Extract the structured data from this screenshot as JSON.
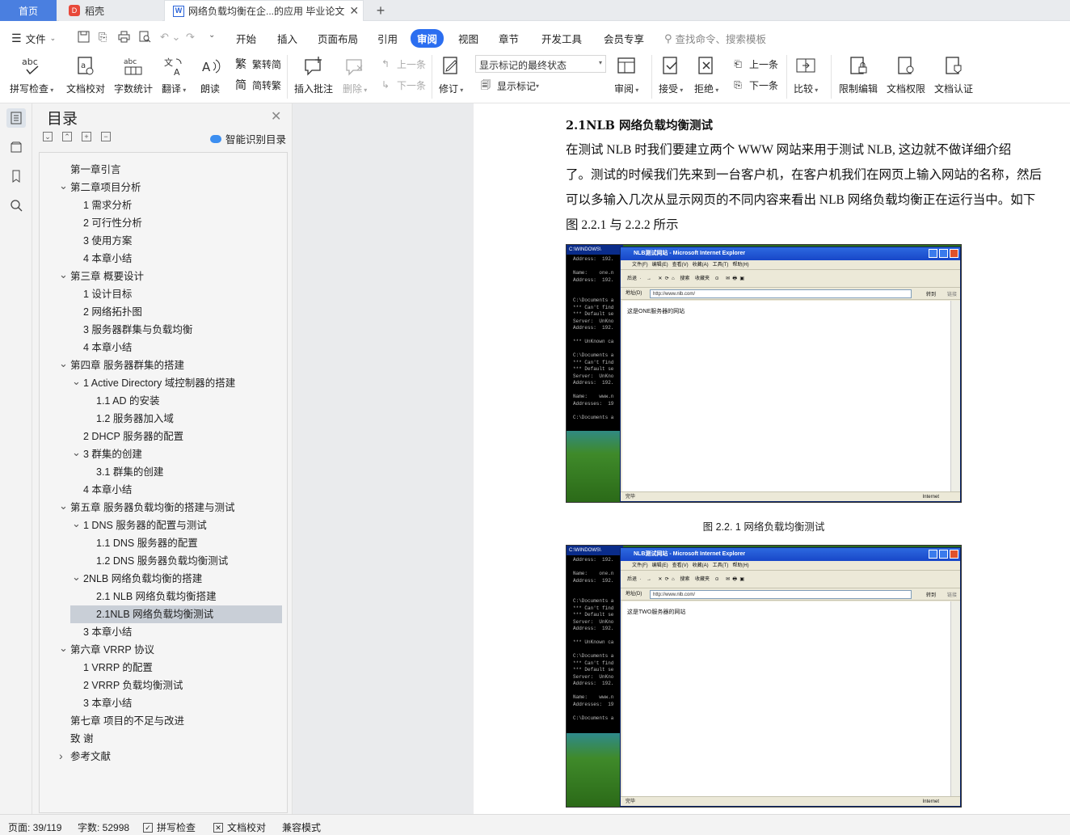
{
  "tabs": {
    "home": "首页",
    "daoke": "稻壳",
    "doc": "网络负载均衡在企...的应用 毕业论文"
  },
  "menu": {
    "file": "文件",
    "items": [
      "开始",
      "插入",
      "页面布局",
      "引用",
      "审阅",
      "视图",
      "章节",
      "开发工具",
      "会员专享"
    ],
    "search": "查找命令、搜索模板"
  },
  "ribbon": {
    "spellcheck": "拼写检查",
    "proofread": "文档校对",
    "wordcount": "字数统计",
    "translate": "翻译",
    "readaloud": "朗读",
    "to_traditional": "繁转简",
    "to_simplified": "简转繁",
    "insert_comment": "插入批注",
    "delete": "删除",
    "prev_comment": "上一条",
    "next_comment": "下一条",
    "revise": "修订",
    "markup_mode": "显示标记的最终状态",
    "show_markup": "显示标记",
    "review": "审阅",
    "accept": "接受",
    "reject": "拒绝",
    "prev_change": "上一条",
    "next_change": "下一条",
    "compare": "比较",
    "restrict_edit": "限制编辑",
    "doc_rights": "文档权限",
    "doc_cert": "文档认证"
  },
  "toc": {
    "title": "目录",
    "smart": "智能识别目录",
    "items": [
      {
        "text": "第一章引言",
        "expand": ""
      },
      {
        "text": "第二章项目分析",
        "expand": "down"
      },
      {
        "text": "1  需求分析",
        "expand": ""
      },
      {
        "text": "2  可行性分析",
        "expand": ""
      },
      {
        "text": "3  使用方案",
        "expand": ""
      },
      {
        "text": "4 本章小结",
        "expand": ""
      },
      {
        "text": "第三章  概要设计",
        "expand": "down"
      },
      {
        "text": "1 设计目标",
        "expand": ""
      },
      {
        "text": "2 网络拓扑图",
        "expand": ""
      },
      {
        "text": "3 服务器群集与负载均衡",
        "expand": ""
      },
      {
        "text": "4 本章小结",
        "expand": ""
      },
      {
        "text": "第四章  服务器群集的搭建",
        "expand": "down"
      },
      {
        "text": "1    Active Directory 域控制器的搭建",
        "expand": "down"
      },
      {
        "text": "1.1    AD 的安装",
        "expand": ""
      },
      {
        "text": "1.2  服务器加入域",
        "expand": ""
      },
      {
        "text": "2    DHCP 服务器的配置",
        "expand": ""
      },
      {
        "text": "3    群集的创建",
        "expand": "down"
      },
      {
        "text": "3.1  群集的创建",
        "expand": ""
      },
      {
        "text": "4    本章小结",
        "expand": ""
      },
      {
        "text": "第五章  服务器负载均衡的搭建与测试",
        "expand": "down"
      },
      {
        "text": "1    DNS 服务器的配置与测试",
        "expand": "down"
      },
      {
        "text": "1.1    DNS 服务器的配置",
        "expand": ""
      },
      {
        "text": "1.2 DNS 服务器负载均衡测试",
        "expand": ""
      },
      {
        "text": "2NLB 网络负载均衡的搭建",
        "expand": "down"
      },
      {
        "text": "2.1    NLB 网络负载均衡搭建",
        "expand": ""
      },
      {
        "text": "2.1NLB 网络负载均衡测试",
        "expand": "",
        "selected": true
      },
      {
        "text": "3    本章小结",
        "expand": ""
      },
      {
        "text": "第六章  VRRP 协议",
        "expand": "down"
      },
      {
        "text": "1 VRRP 的配置",
        "expand": ""
      },
      {
        "text": "2 VRRP 负载均衡测试",
        "expand": ""
      },
      {
        "text": "3   本章小结",
        "expand": ""
      },
      {
        "text": "第七章  项目的不足与改进",
        "expand": ""
      },
      {
        "text": "致    谢",
        "expand": ""
      },
      {
        "text": "参考文献",
        "expand": "right"
      }
    ]
  },
  "doc": {
    "heading": "2.1NLB 网络负载均衡测试",
    "lines": [
      "        在测试 NLB 时我们要建立两个 WWW 网站来用于测试 NLB, 这边就不做详细介绍",
      "了。测试的时候我们先来到一台客户机，在客户机我们在网页上输入网站的名称，然后",
      "可以多输入几次从显示网页的不同内容来看出 NLB 网络负载均衡正在运行当中。如下",
      "图 2.2.1 与 2.2.2 所示"
    ],
    "caption1": "图 2.2. 1 网络负载均衡测试",
    "shot1": {
      "cmd_title": "C:\\WINDOWS\\",
      "cmd_text": "Address:  192.\n\nName:    one.n\nAddress:  192.\n\n\nC:\\Documents a\n*** Can't find\n*** Default se\nServer:  UnKno\nAddress:  192.\n\n*** UnKnown ca\n\nC:\\Documents a\n*** Can't find\n*** Default se\nServer:  UnKno\nAddress:  192.\n\nName:    www.n\nAddresses:  19\n\nC:\\Documents a",
      "title": "NLB测试网站 - Microsoft Internet Explorer",
      "menu": "文件(F)   编辑(E)   查看(V)   收藏(A)   工具(T)   帮助(H)",
      "toolbar": "后退  ·    →     ✕  ⟳  ⌂    搜索    收藏夹    ⊙     ✉  🖶  ▣",
      "addr_label": "地址(D)",
      "url": "http://www.nlb.com/",
      "go": "转到",
      "links": "链接",
      "body": "这是ONE服务器的网站",
      "status": "完毕",
      "zone": "Internet"
    },
    "shot2": {
      "cmd_title": "C:\\WINDOWS\\",
      "cmd_text": "Address:  192.\n\nName:    one.n\nAddress:  192.\n\n\nC:\\Documents a\n*** Can't find\n*** Default se\nServer:  UnKno\nAddress:  192.\n\n*** UnKnown ca\n\nC:\\Documents a\n*** Can't find\n*** Default se\nServer:  UnKno\nAddress:  192.\n\nName:    www.n\nAddresses:  19\n\nC:\\Documents a",
      "title": "NLB测试网站 - Microsoft Internet Explorer",
      "menu": "文件(F)   编辑(E)   查看(V)   收藏(A)   工具(T)   帮助(H)",
      "toolbar": "后退  ·    →     ✕  ⟳  ⌂    搜索    收藏夹    ⊙     ✉  🖶  ▣",
      "addr_label": "地址(D)",
      "url": "http://www.nlb.com/",
      "go": "转到",
      "links": "链接",
      "body": "这是TWO服务器的网站",
      "status": "完毕",
      "zone": "Internet"
    }
  },
  "status": {
    "page": "页面: 39/119",
    "words": "字数: 52998",
    "spell": "拼写检查",
    "proof": "文档校对",
    "compat": "兼容模式"
  },
  "colors": {
    "accent": "#2b6ef0",
    "home_tab": "#4a7fe0",
    "selected_toc": "#c9cfd7"
  }
}
